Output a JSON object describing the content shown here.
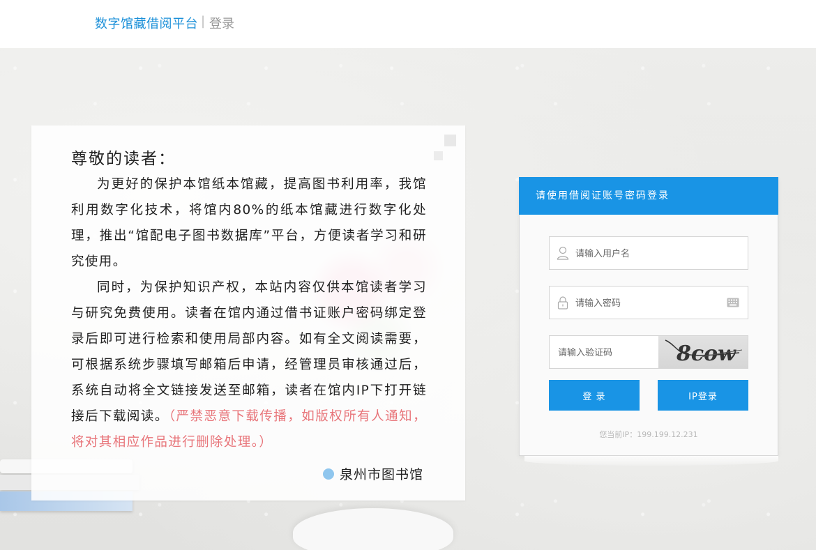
{
  "header": {
    "brand": "数字馆藏借阅平台",
    "separator": "|",
    "subtitle": "登录"
  },
  "notice": {
    "title": "尊敬的读者：",
    "paragraph1": "为更好的保护本馆纸本馆藏，提高图书利用率，我馆利用数字化技术，将馆内80%的纸本馆藏进行数字化处理，推出“馆配电子图书数据库”平台，方便读者学习和研究使用。",
    "paragraph2": "同时，为保护知识产权，本站内容仅供本馆读者学习与研究免费使用。读者在馆内通过借书证账户密码绑定登录后即可进行检索和使用局部内容。如有全文阅读需要，可根据系统步骤填写邮箱后申请，经管理员审核通过后，系统自动将全文链接发送至邮箱，读者在馆内IP下打开链接后下载阅读。",
    "warning": "（严禁恶意下载传播，如版权所有人通知，将对其相应作品进行删除处理。）",
    "signature": "泉州市图书馆"
  },
  "login": {
    "heading": "请使用借阅证账号密码登录",
    "username_placeholder": "请输入用户名",
    "password_placeholder": "请输入密码",
    "captcha_placeholder": "请输入验证码",
    "captcha_text": "8cow",
    "login_button": "登 录",
    "ip_button": "IP登录",
    "ip_label": "您当前IP：",
    "ip_value": "199.199.12.231"
  },
  "colors": {
    "accent": "#1994e5",
    "brand_text": "#1a8fd8",
    "warning_text": "#e8757a"
  },
  "icons": {
    "user": "user-icon",
    "lock": "lock-icon",
    "keyboard": "keyboard-icon",
    "signature_dot": "circle-icon"
  }
}
